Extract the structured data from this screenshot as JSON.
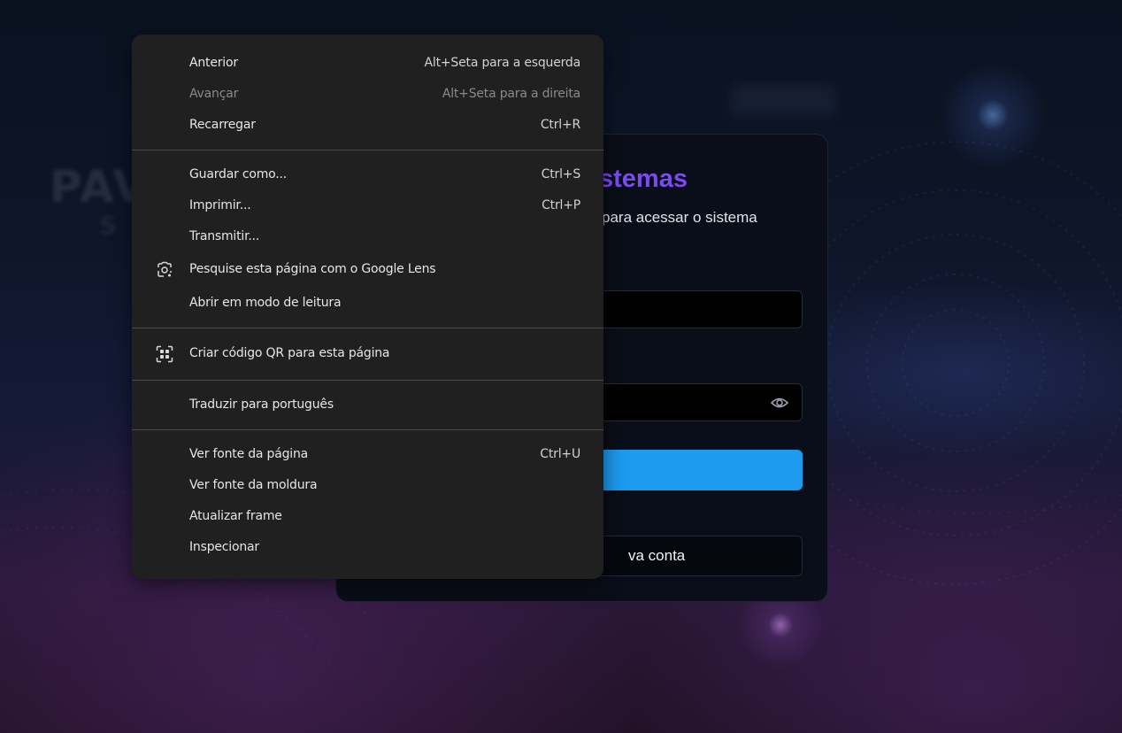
{
  "context_menu": {
    "items": [
      {
        "label": "Anterior",
        "shortcut": "Alt+Seta para a esquerda"
      },
      {
        "label": "Avançar",
        "shortcut": "Alt+Seta para a direita"
      },
      {
        "label": "Recarregar",
        "shortcut": "Ctrl+R"
      },
      {
        "label": "Guardar como...",
        "shortcut": "Ctrl+S"
      },
      {
        "label": "Imprimir...",
        "shortcut": "Ctrl+P"
      },
      {
        "label": "Transmitir..."
      },
      {
        "label": "Pesquise esta página com o Google Lens",
        "icon": "google-lens-icon"
      },
      {
        "label": "Abrir em modo de leitura"
      },
      {
        "label": "Criar código QR para esta página",
        "icon": "qr-code-icon"
      },
      {
        "label": "Traduzir para português"
      },
      {
        "label": "Ver fonte da página",
        "shortcut": "Ctrl+U"
      },
      {
        "label": "Ver fonte da moldura"
      },
      {
        "label": "Atualizar frame"
      },
      {
        "label": "Inspecionar"
      }
    ],
    "disabled_item": "Avançar"
  },
  "login": {
    "title_visible": "stemas",
    "subtitle_visible": "para acessar o sistema",
    "create_account_visible": "va conta",
    "button_color": "#1d9bf0",
    "title_color": "#7b4bf0",
    "password_toggle_icon": "eye-icon"
  }
}
